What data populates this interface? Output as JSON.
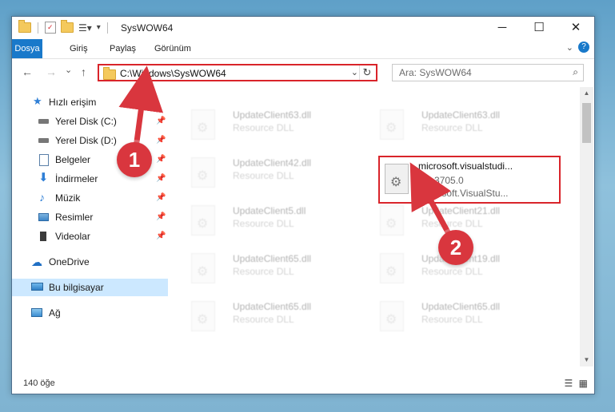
{
  "window": {
    "title": "SysWOW64",
    "controls": {
      "minimize": "─",
      "maximize": "☐",
      "close": "✕"
    }
  },
  "ribbon": {
    "tabs": [
      "Dosya",
      "Giriş",
      "Paylaş",
      "Görünüm"
    ],
    "help": "?"
  },
  "nav": {
    "back": "←",
    "forward": "→",
    "recent": "⌄",
    "up": "↑"
  },
  "address": {
    "path": "C:\\Windows\\SysWOW64",
    "dropdown": "⌄",
    "refresh": "↻"
  },
  "search": {
    "placeholder": "Ara: SysWOW64",
    "icon": "⌕"
  },
  "sidebar": {
    "items": [
      {
        "label": "Hızlı erişim",
        "icon": "star-icon",
        "pinned": false
      },
      {
        "label": "Yerel Disk (C:)",
        "icon": "drive-icon",
        "pinned": true
      },
      {
        "label": "Yerel Disk (D:)",
        "icon": "drive-icon",
        "pinned": true
      },
      {
        "label": "Belgeler",
        "icon": "documents-icon",
        "pinned": true
      },
      {
        "label": "İndirmeler",
        "icon": "download-icon",
        "pinned": true
      },
      {
        "label": "Müzik",
        "icon": "music-icon",
        "pinned": true
      },
      {
        "label": "Resimler",
        "icon": "pictures-icon",
        "pinned": true
      },
      {
        "label": "Videolar",
        "icon": "videos-icon",
        "pinned": true
      },
      {
        "label": "OneDrive",
        "icon": "cloud-icon",
        "pinned": false
      },
      {
        "label": "Bu bilgisayar",
        "icon": "computer-icon",
        "pinned": false,
        "selected": true
      },
      {
        "label": "Ağ",
        "icon": "network-icon",
        "pinned": false
      }
    ],
    "pin_glyph": "📌"
  },
  "files": [
    {
      "name": "UpdateClient63.dll",
      "type": "Resource DLL",
      "faded": true
    },
    {
      "name": "UpdateClient63.dll",
      "type": "Resource DLL",
      "faded": true
    },
    {
      "name": "UpdateClient42.dll",
      "type": "Resource DLL",
      "faded": true
    },
    {
      "name": "microsoft.visualstudi...",
      "version": "1.0.3705.0",
      "type": "Microsoft.VisualStu...",
      "faded": false,
      "highlighted": true
    },
    {
      "name": "UpdateClient5.dll",
      "type": "Resource DLL",
      "faded": true
    },
    {
      "name": "UpdateClient21.dll",
      "type": "Resource DLL",
      "faded": true
    },
    {
      "name": "UpdateClient65.dll",
      "type": "Resource DLL",
      "faded": true
    },
    {
      "name": "UpdateClient19.dll",
      "type": "Resource DLL",
      "faded": true
    },
    {
      "name": "UpdateClient65.dll",
      "type": "Resource DLL",
      "faded": true
    },
    {
      "name": "UpdateClient65.dll",
      "type": "Resource DLL",
      "faded": true
    }
  ],
  "status": {
    "count": "140 öğe"
  },
  "annotations": {
    "step1": "1",
    "step2": "2",
    "color": "#d9363e"
  }
}
